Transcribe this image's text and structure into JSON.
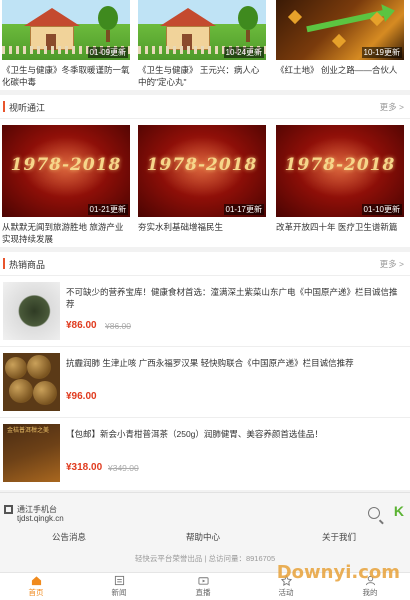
{
  "top_videos": [
    {
      "badge": "01-09更新",
      "caption": "《卫生与健康》冬季取暖谨防一氧化碳中毒"
    },
    {
      "badge": "10-24更新",
      "caption": "《卫生与健康》  王元兴：病人心中的\"定心丸\""
    },
    {
      "badge": "10-19更新",
      "caption": "《红土地》  创业之路——合伙人"
    }
  ],
  "video_section": {
    "title": "视听通江",
    "more": "更多 >",
    "videos": [
      {
        "image_text": "1978-2018",
        "badge": "01-21更新",
        "caption": "从默默无闻到旅游胜地  旅游产业实现持续发展"
      },
      {
        "image_text": "1978-2018",
        "badge": "01-17更新",
        "caption": "夯实水利基础增福民生"
      },
      {
        "image_text": "1978-2018",
        "badge": "01-10更新",
        "caption": "改革开放四十年  医疗卫生谱新篇"
      }
    ]
  },
  "product_section": {
    "title": "热销商品",
    "more": "更多 >",
    "products": [
      {
        "name": "不可缺少的营养宝库！健康食材首选：潼满深土紫菜山东广电《中国原产递》栏目诚信推荐",
        "price": "¥86.00",
        "old_price": "¥86.00"
      },
      {
        "name": "抗霾润肺 生津止咳 广西永福罗汉果 轻快购联合《中国原产递》栏目诚信推荐",
        "price": "¥96.00",
        "old_price": ""
      },
      {
        "name": "【包邮】新会小青柑普洱茶（250g）润肺健胃、美容养颜首选佳品！",
        "price": "¥318.00",
        "old_price": "¥349.00",
        "image_text": "金桔普洱柑之美"
      }
    ]
  },
  "footer": {
    "site_name": "通江手机台",
    "site_url": "tjdst.qingk.cn",
    "links": [
      "公告消息",
      "帮助中心",
      "关于我们"
    ],
    "copyright": "轻快云平台荣誉出品  |  总访问量：8916705",
    "brand_letter": "K"
  },
  "tabs": [
    {
      "label": "首页",
      "icon": "home-icon",
      "active": true
    },
    {
      "label": "新闻",
      "icon": "news-icon",
      "active": false
    },
    {
      "label": "直播",
      "icon": "live-icon",
      "active": false
    },
    {
      "label": "活动",
      "icon": "activity-icon",
      "active": false
    },
    {
      "label": "我的",
      "icon": "profile-icon",
      "active": false
    }
  ],
  "watermark": "Downyi.com",
  "colors": {
    "accent": "#e8542c",
    "price": "#e03a1e",
    "tab_active": "#f08a1d",
    "brand_green": "#5bb333"
  }
}
